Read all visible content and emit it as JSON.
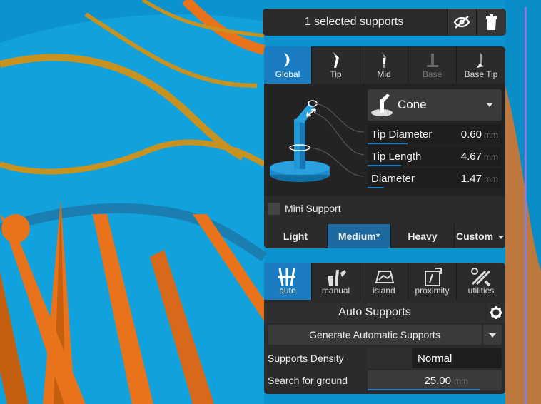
{
  "header": {
    "selected_label": "1 selected supports",
    "hide_icon": "eye-off-icon",
    "delete_icon": "trash-icon"
  },
  "tip_tabs": [
    {
      "label": "Global",
      "icon": "global-tip-icon",
      "state": "active"
    },
    {
      "label": "Tip",
      "icon": "tip-icon",
      "state": "normal"
    },
    {
      "label": "Mid",
      "icon": "mid-icon",
      "state": "normal"
    },
    {
      "label": "Base",
      "icon": "base-icon",
      "state": "disabled"
    },
    {
      "label": "Base Tip",
      "icon": "base-tip-icon",
      "state": "normal"
    }
  ],
  "shape": {
    "value": "Cone",
    "icon": "cone-icon"
  },
  "fields": [
    {
      "label": "Tip Diameter",
      "value": "0.60",
      "unit": "mm",
      "fill": 0.3
    },
    {
      "label": "Tip Length",
      "value": "4.67",
      "unit": "mm",
      "fill": 0.25
    },
    {
      "label": "Diameter",
      "value": "1.47",
      "unit": "mm",
      "fill": 0.12
    }
  ],
  "mini_support": {
    "label": "Mini Support",
    "checked": false
  },
  "presets": {
    "items": [
      "Light",
      "Medium*",
      "Heavy",
      "Custom"
    ],
    "active": "Medium*"
  },
  "mode_tabs": [
    {
      "label": "auto",
      "icon": "auto-icon",
      "state": "active"
    },
    {
      "label": "manual",
      "icon": "manual-icon",
      "state": "normal"
    },
    {
      "label": "island",
      "icon": "island-icon",
      "state": "normal"
    },
    {
      "label": "proximity",
      "icon": "proximity-icon",
      "state": "normal"
    },
    {
      "label": "utilities",
      "icon": "tools-icon",
      "state": "normal"
    }
  ],
  "auto": {
    "title": "Auto Supports",
    "generate_label": "Generate Automatic Supports",
    "density_label": "Supports Density",
    "density_value": "Normal",
    "ground_label": "Search for ground",
    "ground_value": "25.00",
    "ground_unit": "mm"
  },
  "colors": {
    "accent": "#1c7cc2",
    "panel": "#2b2b2b",
    "model_blue": "#0a9bd8",
    "support_orange": "#e8731a"
  }
}
